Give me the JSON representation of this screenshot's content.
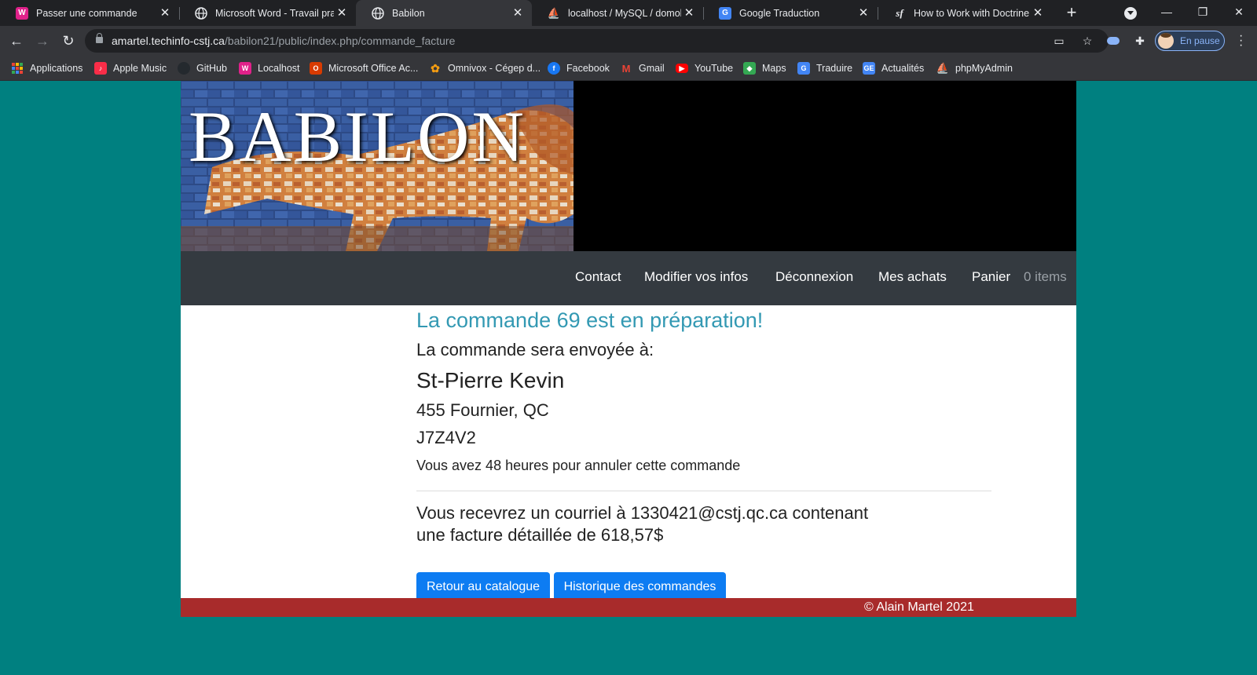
{
  "browser": {
    "tabs": [
      {
        "title": "Passer une commande",
        "icon": "localhost-icon"
      },
      {
        "title": "Microsoft Word - Travail pratique",
        "icon": "globe-icon"
      },
      {
        "title": "Babilon",
        "icon": "globe-icon"
      },
      {
        "title": "localhost / MySQL / domobjet",
        "icon": "phpmyadmin-icon"
      },
      {
        "title": "Google Traduction",
        "icon": "google-translate-icon"
      },
      {
        "title": "How to Work with Doctrine Associations",
        "icon": "symfony-icon"
      }
    ],
    "url_host": "amartel.techinfo-cstj.ca",
    "url_path": "/babilon21/public/index.php/commande_facture",
    "profile_label": "En pause",
    "bookmarks": [
      {
        "label": "Applications",
        "icon": "apps-grid-icon"
      },
      {
        "label": "Apple Music",
        "icon": "apple-music-icon",
        "color": "#fa2d48"
      },
      {
        "label": "GitHub",
        "icon": "github-icon",
        "color": "#24292e"
      },
      {
        "label": "Localhost",
        "icon": "localhost-icon",
        "color": "#e0218a"
      },
      {
        "label": "Microsoft Office Ac...",
        "icon": "office-icon",
        "color": "#d83b01"
      },
      {
        "label": "Omnivox - Cégep d...",
        "icon": "omnivox-icon",
        "color": "#f39c12"
      },
      {
        "label": "Facebook",
        "icon": "facebook-icon",
        "color": "#1877f2"
      },
      {
        "label": "Gmail",
        "icon": "gmail-icon",
        "color": "#ea4335"
      },
      {
        "label": "YouTube",
        "icon": "youtube-icon",
        "color": "#ff0000"
      },
      {
        "label": "Maps",
        "icon": "maps-icon",
        "color": "#34a853"
      },
      {
        "label": "Traduire",
        "icon": "translate-icon",
        "color": "#4285f4"
      },
      {
        "label": "Actualités",
        "icon": "news-icon",
        "color": "#4285f4"
      },
      {
        "label": "phpMyAdmin",
        "icon": "phpmyadmin-icon",
        "color": "#f89c0e"
      }
    ]
  },
  "site": {
    "banner_text": "BABILON",
    "nav": {
      "contact": "Contact",
      "modifier": "Modifier vos infos",
      "deconnexion": "Déconnexion",
      "achats": "Mes achats",
      "panier": "Panier",
      "items": "0 items"
    },
    "order": {
      "title": "La commande 69 est en préparation!",
      "sent_to": "La commande sera envoyée à:",
      "name": "St-Pierre Kevin",
      "address": "455 Fournier, QC",
      "postal": "J7Z4V2",
      "cancel_notice": "Vous avez 48 heures pour annuler cette commande",
      "email_line1": "Vous recevrez un courriel à 1330421@cstj.qc.ca contenant",
      "email_line2": "une facture détaillée de 618,57$"
    },
    "buttons": {
      "catalogue": "Retour au catalogue",
      "historique": "Historique des commandes"
    },
    "footer": "© Alain Martel 2021"
  },
  "colors": {
    "page_bg": "#008080",
    "title": "#3399b3",
    "button": "#0d7cf2",
    "navbar": "#343a40",
    "footer": "#a82b2b"
  }
}
